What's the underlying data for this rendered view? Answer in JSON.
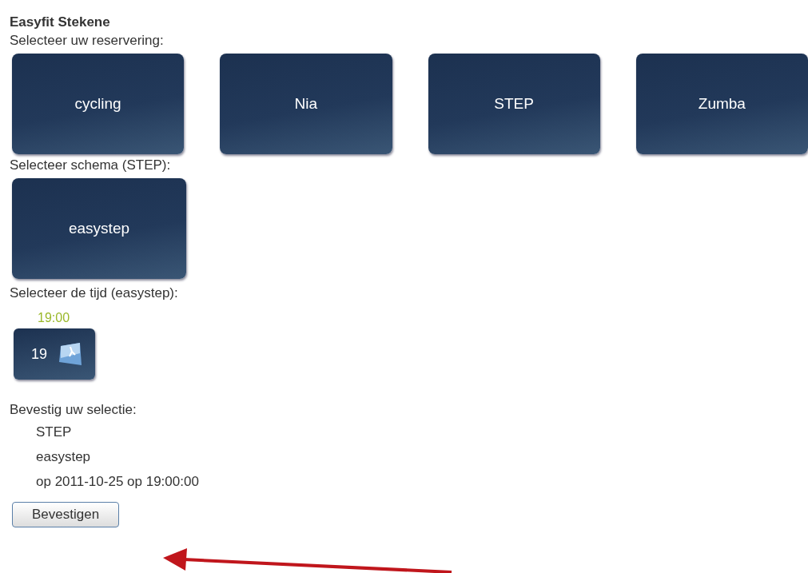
{
  "title": "Easyfit Stekene",
  "reservation": {
    "label": "Selecteer uw reservering:",
    "options": [
      "cycling",
      "Nia",
      "STEP",
      "Zumba"
    ]
  },
  "schema": {
    "label": "Selecteer schema (STEP):",
    "options": [
      "easystep"
    ]
  },
  "time": {
    "label": "Selecteer de tijd (easystep):",
    "slots": [
      {
        "time": "19:00",
        "hour": "19"
      }
    ]
  },
  "confirm": {
    "label": "Bevestig uw selectie:",
    "lines": [
      "STEP",
      "easystep",
      "op 2011-10-25 op 19:00:00"
    ],
    "button": "Bevestigen"
  }
}
